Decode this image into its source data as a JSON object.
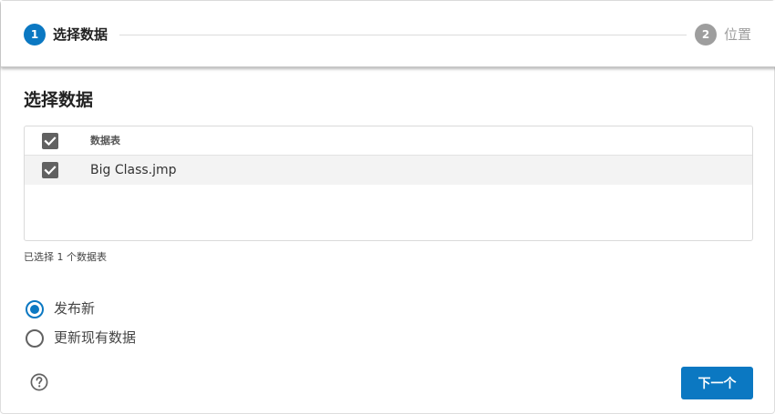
{
  "stepper": {
    "steps": [
      {
        "number": "1",
        "label": "选择数据",
        "active": true
      },
      {
        "number": "2",
        "label": "位置",
        "active": false
      }
    ]
  },
  "section": {
    "title": "选择数据"
  },
  "table": {
    "header": {
      "column": "数据表",
      "select_all_checked": true
    },
    "rows": [
      {
        "name": "Big Class.jmp",
        "checked": true
      }
    ]
  },
  "selection_count": "已选择 1 个数据表",
  "publish_options": [
    {
      "label": "发布新",
      "selected": true
    },
    {
      "label": "更新现有数据",
      "selected": false
    }
  ],
  "footer": {
    "help_icon": "question-circle-icon",
    "next_label": "下一个"
  },
  "colors": {
    "accent": "#0b78c2",
    "inactive": "#9e9e9e",
    "checkbox": "#616161"
  }
}
